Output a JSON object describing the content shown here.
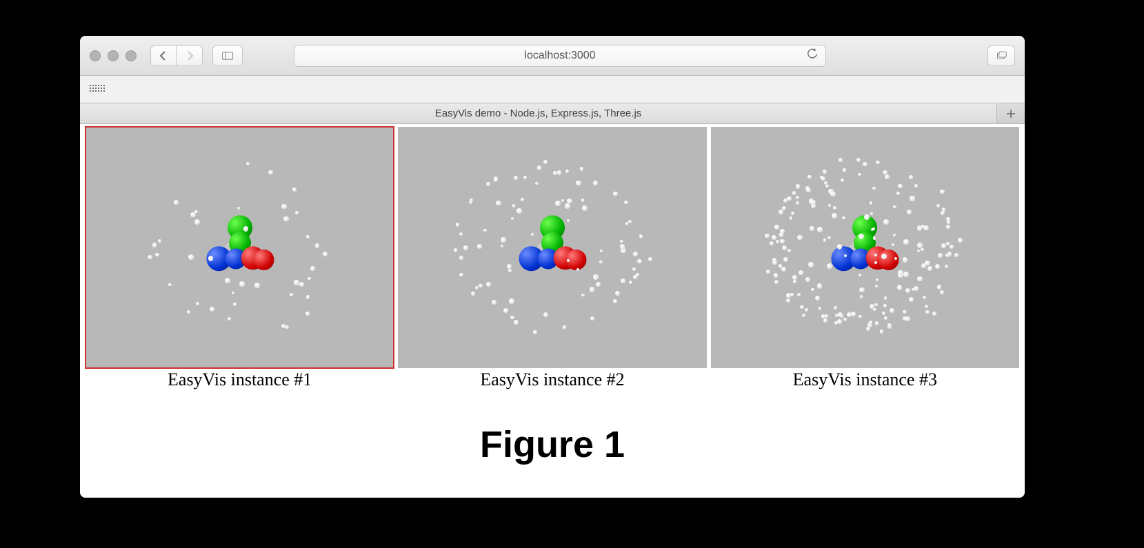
{
  "browser": {
    "url": "localhost:3000",
    "tab_title": "EasyVis demo - Node.js, Express.js, Three.js"
  },
  "page": {
    "instances": [
      {
        "caption": "EasyVis instance #1",
        "active": true,
        "dot_count": 40
      },
      {
        "caption": "EasyVis instance #2",
        "active": false,
        "dot_count": 80
      },
      {
        "caption": "EasyVis instance #3",
        "active": false,
        "dot_count": 180
      }
    ],
    "figure_label": "Figure 1"
  }
}
